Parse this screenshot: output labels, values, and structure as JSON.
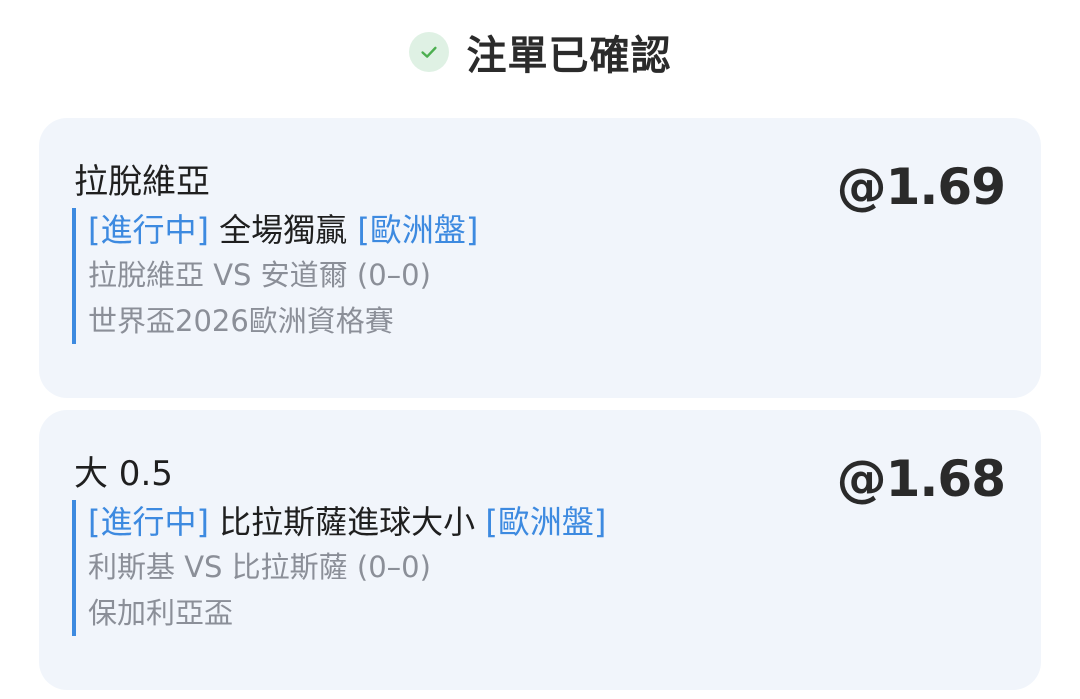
{
  "header": {
    "title": "注單已確認",
    "icon": "check-circle-icon",
    "icon_color": "#4caf50"
  },
  "bets": [
    {
      "selection": "拉脫維亞",
      "odds": "@1.69",
      "status": "[進行中]",
      "market": "全場獨贏",
      "handicap_type": "[歐洲盤]",
      "match": "拉脫維亞 VS 安道爾 (0–0)",
      "league": "世界盃2026歐洲資格賽"
    },
    {
      "selection": "大 0.5",
      "odds": "@1.68",
      "status": "[進行中]",
      "market": "比拉斯薩進球大小",
      "handicap_type": "[歐洲盤]",
      "match": "利斯基 VS 比拉斯薩 (0–0)",
      "league": "保加利亞盃"
    }
  ],
  "colors": {
    "accent": "#3d8ae0",
    "card_bg": "#f1f5fb",
    "muted_text": "#8b8f98"
  }
}
